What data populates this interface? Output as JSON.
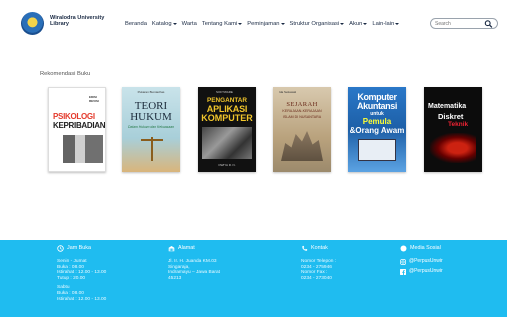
{
  "header": {
    "brand_line1": "Wiralodra University",
    "brand_line2": "Library",
    "search_placeholder": "Search"
  },
  "nav": [
    {
      "label": "Beranda",
      "dropdown": false
    },
    {
      "label": "Katalog",
      "dropdown": true
    },
    {
      "label": "Warta",
      "dropdown": false
    },
    {
      "label": "Tentang Kami",
      "dropdown": true
    },
    {
      "label": "Peminjaman",
      "dropdown": true
    },
    {
      "label": "Struktur Organisasi",
      "dropdown": true
    },
    {
      "label": "Akun",
      "dropdown": true
    },
    {
      "label": "Lain-lain",
      "dropdown": true
    }
  ],
  "main": {
    "section_title": "Rekomendasi Buku",
    "books": [
      {
        "title_a": "PSIKOLOGI",
        "title_b": "KEPRIBADIAN",
        "mini": "EDISI REVISI"
      },
      {
        "title_a": "TEORI",
        "title_b": "HUKUM",
        "subtitle": "Dalam Hukum dan Kekuasaan",
        "top": "Pukaran Bumiachas"
      },
      {
        "top": "SOFTWARE",
        "title_a": "PENGANTAR",
        "title_b": "APLIKASI",
        "title_c": "KOMPUTER",
        "author": "DWIYA R. N."
      },
      {
        "top": "Ida Setiawati",
        "title_a": "SEJARAH",
        "title_b": "KERAJAAN-KERAJAAN",
        "title_c": "ISLAM DI NUSANTARA"
      },
      {
        "title_a": "Komputer",
        "title_b": "Akuntansi",
        "title_c": "untuk",
        "title_d": "Pemula",
        "title_e": "&Orang Awam"
      },
      {
        "title_a": "Matematika",
        "title_b": "Diskret",
        "title_c": "Teknik"
      }
    ]
  },
  "footer": {
    "hours": {
      "heading": "Jam Buka",
      "block1_title": "Senin - Jumat",
      "block1_lines": [
        "Buka : 08.00",
        "Istirahat : 12.00 - 13.00",
        "Tutup : 20.00"
      ],
      "block2_title": "Sabtu",
      "block2_lines": [
        "Buka : 08.00",
        "Istirahat : 12.00 - 13.00"
      ]
    },
    "address": {
      "heading": "Alamat",
      "lines": [
        "Jl. Ir. H. Juanda KM.03",
        "Singaraja,",
        "Indramayu – Jawa Barat",
        "45213"
      ]
    },
    "contact": {
      "heading": "Kontak",
      "phone_label": "Nomor Telepon :",
      "phone": "0234 - 275946",
      "fax_label": "Nomor Fax :",
      "fax": "0234 - 273040"
    },
    "social": {
      "heading": "Media Sosial",
      "instagram": "@PerpusUnwir",
      "facebook": "@PerpusUnwir"
    }
  }
}
